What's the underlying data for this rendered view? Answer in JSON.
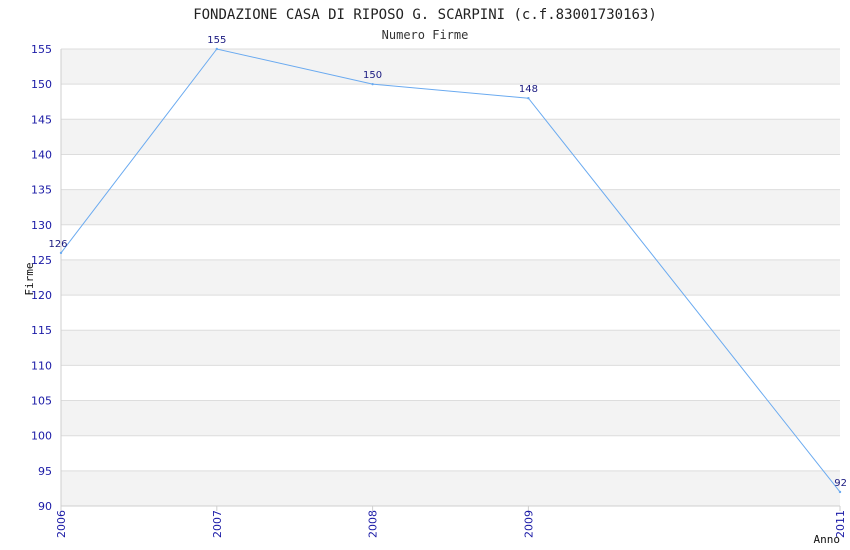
{
  "chart_data": {
    "type": "line",
    "title": "FONDAZIONE CASA DI RIPOSO G. SCARPINI (c.f.83001730163)",
    "subtitle": "Numero Firme",
    "xlabel": "Anno",
    "ylabel": "Firme",
    "x": [
      "2006",
      "2007",
      "2008",
      "2009",
      "2011"
    ],
    "x_ticks": [
      "2006",
      "2007",
      "2008",
      "2009",
      "2011"
    ],
    "series": [
      {
        "values": [
          126,
          155,
          150,
          148,
          92
        ]
      }
    ],
    "ylim": [
      90,
      155
    ],
    "y_ticks": [
      90,
      95,
      100,
      105,
      110,
      115,
      120,
      125,
      130,
      135,
      140,
      145,
      150,
      155
    ],
    "grid": "horizontal alternating bands",
    "colors": {
      "line": "#6aaaf0",
      "band": "#f3f3f3",
      "grid": "#dddddd",
      "tick_label": "#1a1aa6",
      "data_label": "#1a1a80"
    }
  }
}
